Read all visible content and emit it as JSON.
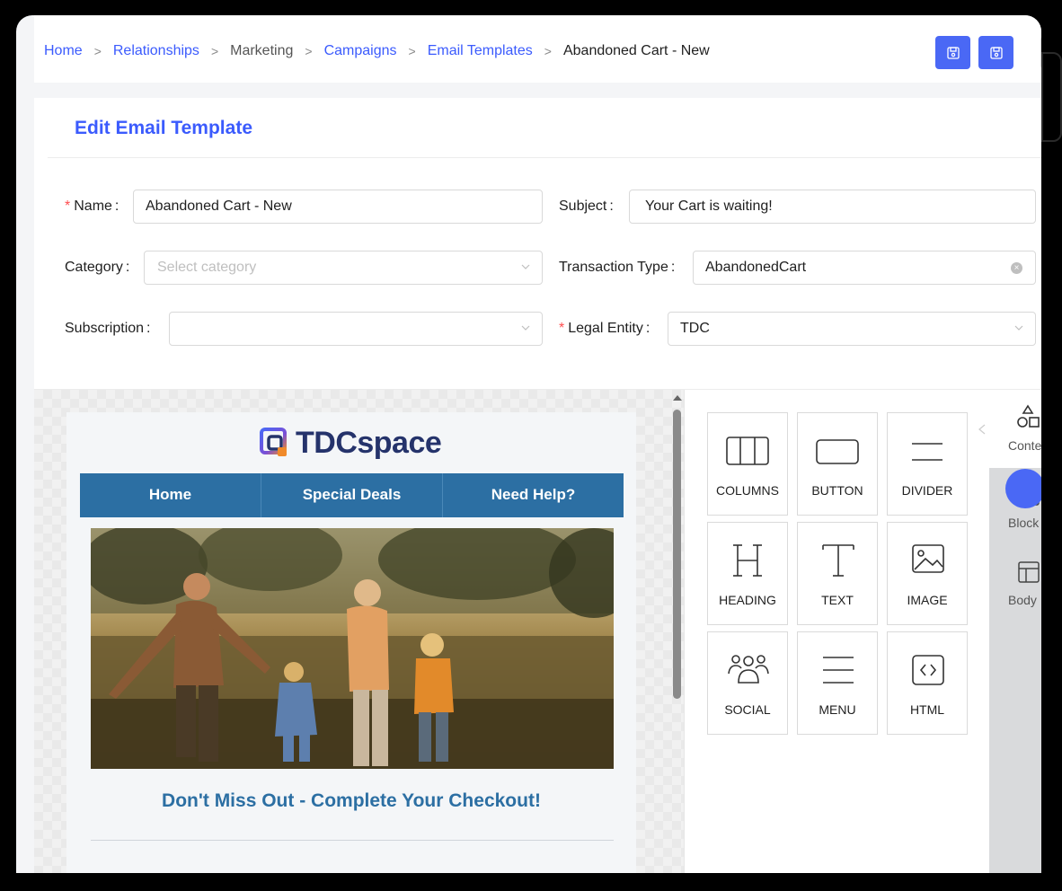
{
  "breadcrumb": {
    "home": "Home",
    "relationships": "Relationships",
    "marketing": "Marketing",
    "campaigns": "Campaigns",
    "email_templates": "Email Templates",
    "current": "Abandoned Cart - New",
    "separator": ">"
  },
  "header": {
    "more_label": "··"
  },
  "card": {
    "title": "Edit Email Template"
  },
  "form": {
    "name_label": "Name",
    "name_value": "Abandoned Cart - New",
    "subject_label": "Subject",
    "subject_value": "Your Cart is waiting!",
    "category_label": "Category",
    "category_placeholder": "Select category",
    "transaction_type_label": "Transaction Type",
    "transaction_type_value": "AbandonedCart",
    "subscription_label": "Subscription",
    "subscription_value": "",
    "legal_entity_label": "Legal Entity",
    "legal_entity_value": "TDC",
    "label_suffix": ":"
  },
  "email": {
    "logo_text": "TDCspace",
    "nav": [
      "Home",
      "Special Deals",
      "Need Help?"
    ],
    "headline": "Don't Miss Out - Complete Your Checkout!"
  },
  "tools": [
    {
      "label": "COLUMNS",
      "icon": "columns-icon"
    },
    {
      "label": "BUTTON",
      "icon": "button-icon"
    },
    {
      "label": "DIVIDER",
      "icon": "divider-icon"
    },
    {
      "label": "HEADING",
      "icon": "heading-icon"
    },
    {
      "label": "TEXT",
      "icon": "text-icon"
    },
    {
      "label": "IMAGE",
      "icon": "image-icon"
    },
    {
      "label": "SOCIAL",
      "icon": "social-icon"
    },
    {
      "label": "MENU",
      "icon": "menu-icon"
    },
    {
      "label": "HTML",
      "icon": "html-icon"
    }
  ],
  "rail": {
    "content": "Conte",
    "blocks": "Block",
    "body": "Body"
  },
  "colors": {
    "accent": "#3b5bfd",
    "button": "#4a68f5",
    "email_nav": "#2c6fa3",
    "logo": "#25336b"
  }
}
